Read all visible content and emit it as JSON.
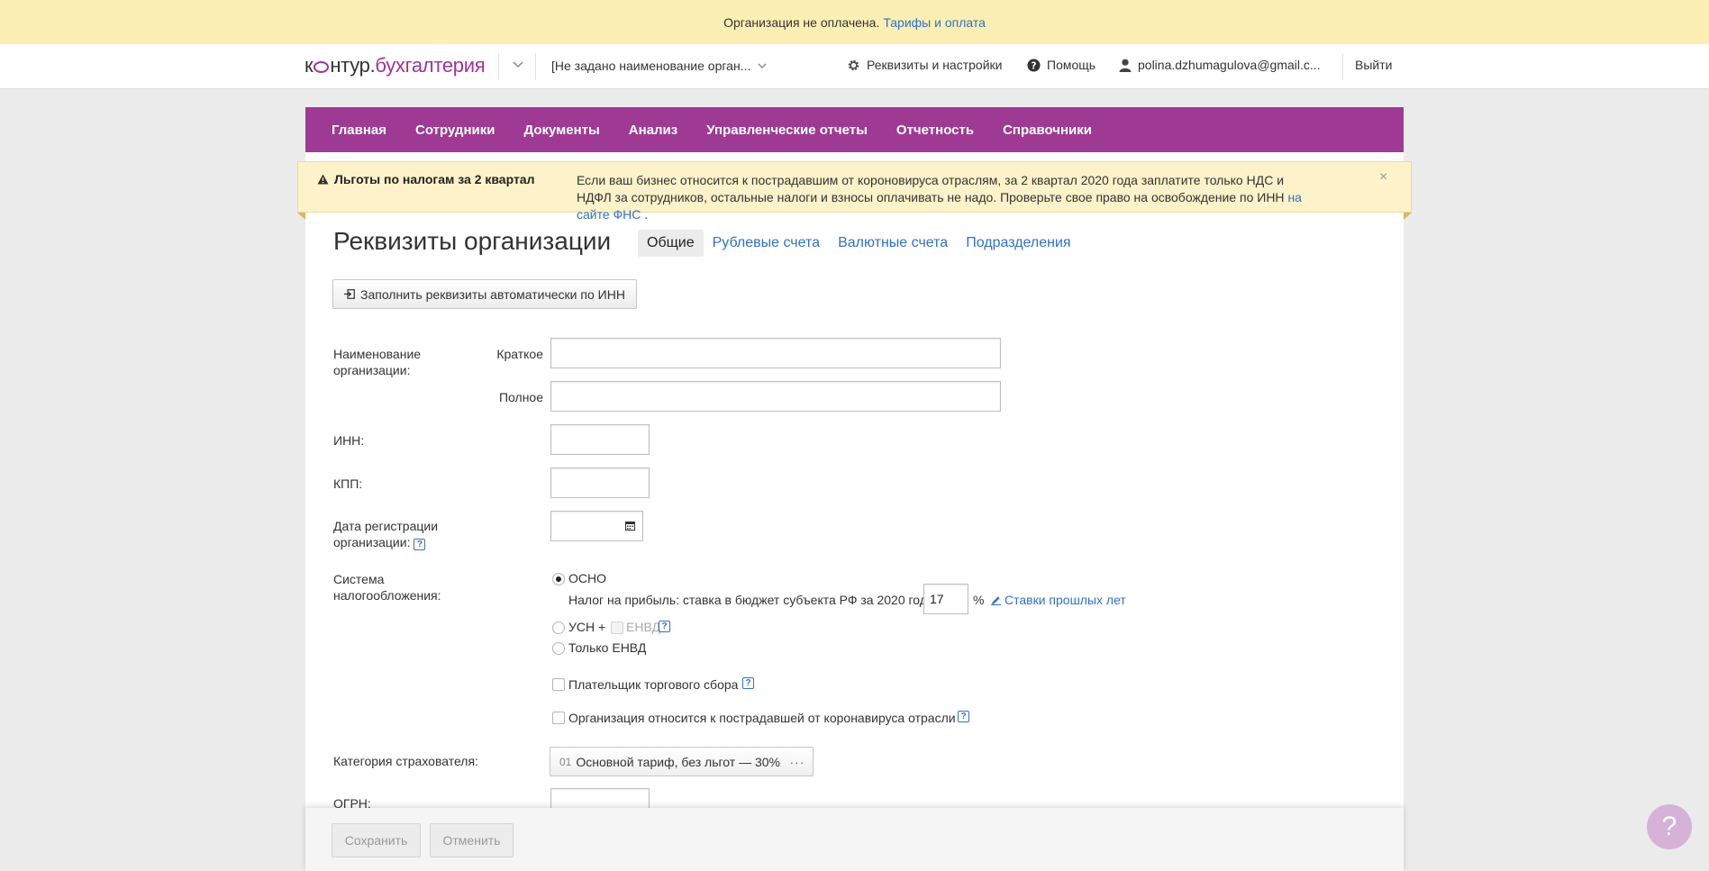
{
  "banner": {
    "text": "Организация не оплачена.",
    "link": "Тарифы и оплата"
  },
  "header": {
    "logo_part1": "к",
    "logo_part2": "нтур.",
    "logo_part3": "бухгалтерия",
    "org_name": "[Не задано наименование орган...",
    "settings": "Реквизиты и настройки",
    "help": "Помощь",
    "user": "polina.dzhumagulova@gmail.c...",
    "logout": "Выйти"
  },
  "nav": {
    "items": [
      "Главная",
      "Сотрудники",
      "Документы",
      "Анализ",
      "Управленческие отчеты",
      "Отчетность",
      "Справочники"
    ]
  },
  "notice": {
    "title": "Льготы по налогам за 2 квартал",
    "text": "Если ваш бизнес относится к пострадавшим от короновируса отраслям, за 2 квартал 2020 года заплатите только НДС и НДФЛ за сотрудников, остальные налоги и взносы оплачивать не надо. Проверьте свое право на освобождение по ИНН",
    "link": "на сайте ФНС",
    "link_suffix": " .",
    "close": "×"
  },
  "page": {
    "title": "Реквизиты организации",
    "tabs": [
      "Общие",
      "Рублевые счета",
      "Валютные счета",
      "Подразделения"
    ],
    "fill_button": "Заполнить реквизиты автоматически по ИНН"
  },
  "form": {
    "org_name_label_1": "Наименование",
    "org_name_label_2": "организации:",
    "short_label": "Краткое",
    "full_label": "Полное",
    "short_value": "",
    "full_value": "",
    "inn_label": "ИНН:",
    "inn_value": "",
    "kpp_label": "КПП:",
    "kpp_value": "",
    "reg_date_label_1": "Дата регистрации",
    "reg_date_label_2": "организации:",
    "reg_date_value": "",
    "tax_label_1": "Система",
    "tax_label_2": "налогообложения:",
    "osno": "ОСНО",
    "profit_tax_text": "Налог на прибыль: ставка в бюджет субъекта РФ за 2020 год",
    "profit_tax_rate": "17",
    "percent": "%",
    "past_rates_link": "Ставки прошлых лет",
    "usn": "УСН +",
    "envd": "ЕНВД",
    "only_envd": "Только ЕНВД",
    "trade_fee": "Плательщик торгового сбора",
    "covid_affected": "Организация относится к пострадавшей от коронавируса отрасли",
    "insurer_label": "Категория страхователя:",
    "insurer_code": "01",
    "insurer_value": "Основной тариф, без льгот — 30%",
    "insurer_more": "···",
    "ogrn_label": "ОГРН:",
    "help_mark": "?"
  },
  "footer": {
    "save": "Сохранить",
    "cancel": "Отменить"
  },
  "help_bubble": "?",
  "colors": {
    "brand": "#9e3a93",
    "link": "#3072c4",
    "banner": "#fcefb4",
    "notice": "#fdf2c9"
  }
}
